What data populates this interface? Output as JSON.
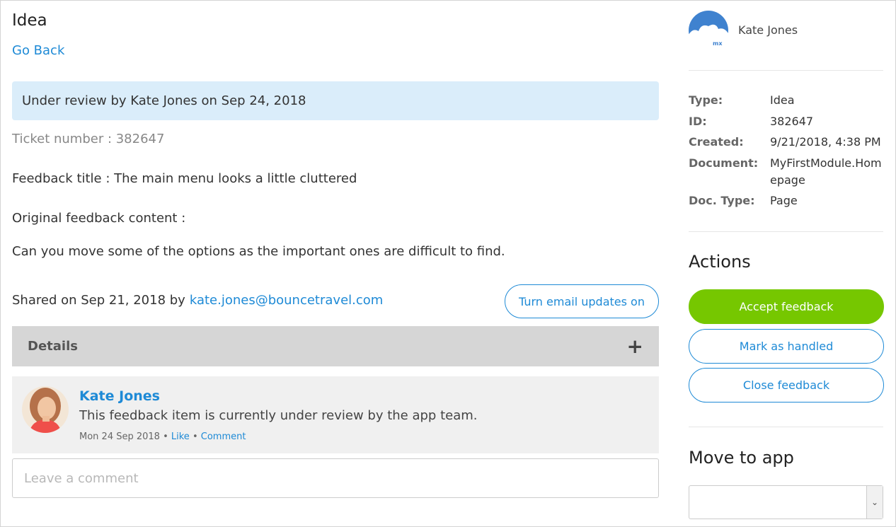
{
  "page": {
    "title": "Idea",
    "go_back": "Go Back",
    "status_banner": "Under review by Kate Jones on Sep 24, 2018",
    "ticket": "Ticket number : 382647",
    "feedback_title": "Feedback title : The main menu looks a little cluttered",
    "original_label": "Original feedback content :",
    "original_content": "Can you move some of the options as the important ones are difficult to find.",
    "shared_text": "Shared on Sep 21, 2018 by",
    "shared_email": "kate.jones@bouncetravel.com",
    "email_updates_button": "Turn email updates on",
    "details_label": "Details",
    "details_toggle": "+"
  },
  "comment": {
    "author": "Kate Jones",
    "text": "This feedback item is currently under review by the app team.",
    "date": "Mon 24 Sep 2018",
    "separator": "•",
    "like": "Like",
    "comment_link": "Comment"
  },
  "comment_input": {
    "placeholder": "Leave a comment"
  },
  "sidebar": {
    "user_name": "Kate Jones",
    "avatar_badge": "mx",
    "meta": [
      {
        "label": "Type:",
        "value": "Idea"
      },
      {
        "label": "ID:",
        "value": "382647"
      },
      {
        "label": "Created:",
        "value": "9/21/2018, 4:38 PM"
      },
      {
        "label": "Document:",
        "value": "MyFirstModule.Homepage"
      },
      {
        "label": "Doc. Type:",
        "value": "Page"
      }
    ],
    "actions_title": "Actions",
    "accept_button": "Accept feedback",
    "handled_button": "Mark as handled",
    "close_button": "Close feedback",
    "move_title": "Move to app",
    "select_value": ""
  },
  "colors": {
    "accent": "#1e8ad6",
    "accept": "#76c700",
    "banner": "#daedfa",
    "details_bar": "#d6d6d6"
  }
}
